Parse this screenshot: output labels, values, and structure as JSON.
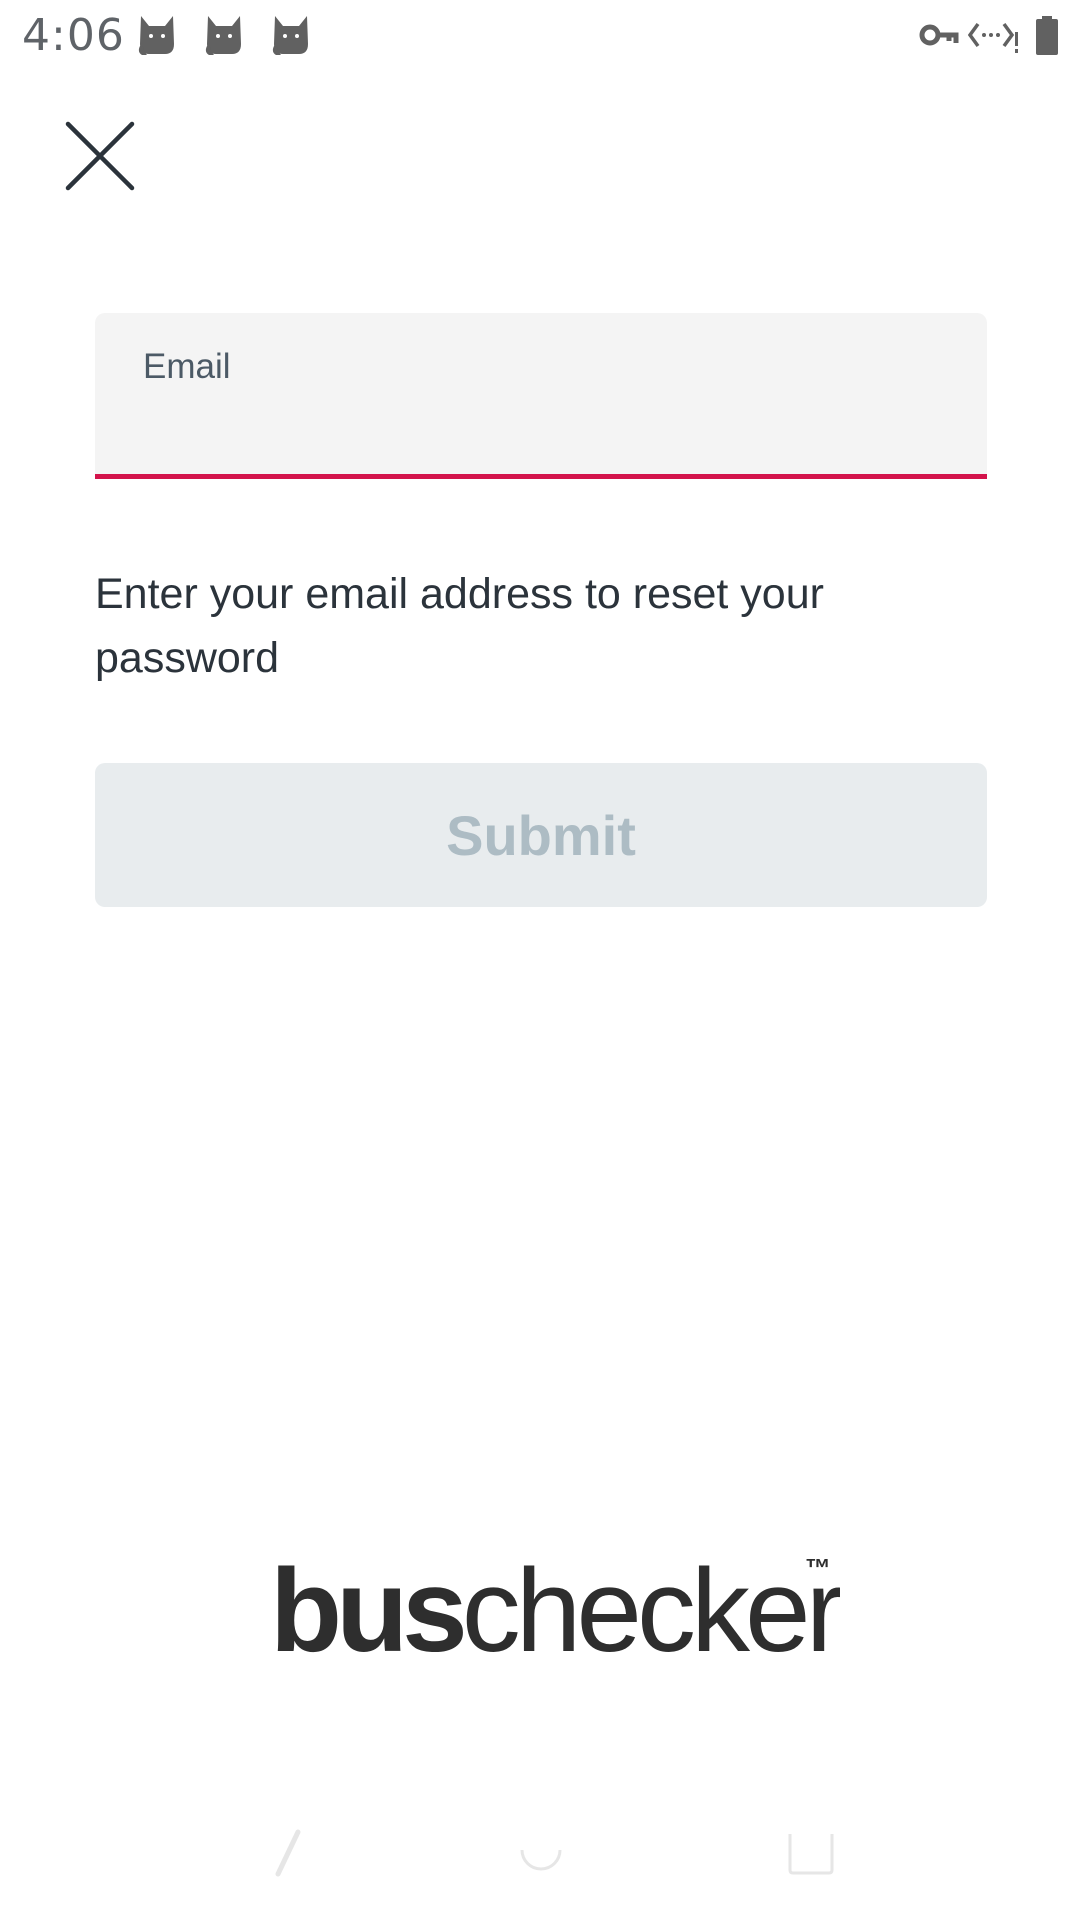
{
  "status_bar": {
    "time": "4:06",
    "icons": [
      "cat-icon",
      "cat-icon",
      "cat-icon",
      "vpn-key-icon",
      "data-transfer-icon",
      "battery-icon"
    ]
  },
  "toolbar": {
    "close_icon": "close-icon"
  },
  "form": {
    "email_label": "Email",
    "email_value": "",
    "helper_text": "Enter your email address to reset your password",
    "submit_label": "Submit"
  },
  "branding": {
    "logo_bold": "bus",
    "logo_light": "checker",
    "trademark": "™"
  },
  "nav_bar": {
    "back_icon": "back-icon",
    "home_icon": "home-icon",
    "recents_icon": "recents-icon"
  },
  "colors": {
    "accent": "#d3134b",
    "text": "#2b333b",
    "field_bg": "#f4f4f4",
    "button_disabled_bg": "#e8ecee",
    "button_disabled_text": "#adbcc4"
  }
}
